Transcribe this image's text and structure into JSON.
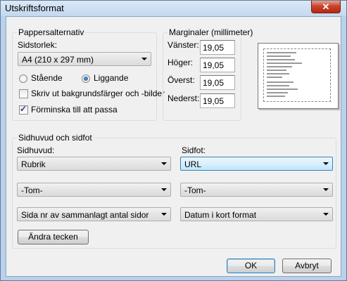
{
  "window": {
    "title": "Utskriftsformat"
  },
  "paper_options": {
    "group_label": "Pappersalternativ",
    "size_label": "Sidstorlek:",
    "size_value": "A4 (210 x 297 mm)",
    "portrait_label": "Stående",
    "landscape_label": "Liggande",
    "orientation_selected": "landscape",
    "print_background_label": "Skriv ut bakgrundsfärger och -bilder",
    "print_background_checked": false,
    "shrink_to_fit_label": "Förminska till att passa",
    "shrink_to_fit_checked": true
  },
  "margins": {
    "group_label": "Marginaler (millimeter)",
    "left_label": "Vänster:",
    "left_value": "19,05",
    "right_label": "Höger:",
    "right_value": "19,05",
    "top_label": "Överst:",
    "top_value": "19,05",
    "bottom_label": "Nederst:",
    "bottom_value": "19,05"
  },
  "header_footer": {
    "group_label": "Sidhuvud och sidfot",
    "header_label": "Sidhuvud:",
    "footer_label": "Sidfot:",
    "header_1": "Rubrik",
    "header_2": "-Tom-",
    "header_3": "Sida nr av sammanlagt antal sidor",
    "footer_1": "URL",
    "footer_2": "-Tom-",
    "footer_3": "Datum i kort format",
    "change_font_label": "Ändra tecken"
  },
  "buttons": {
    "ok": "OK",
    "cancel": "Avbryt"
  },
  "icons": {
    "close": "close-icon",
    "dropdown": "chevron-down-icon"
  }
}
